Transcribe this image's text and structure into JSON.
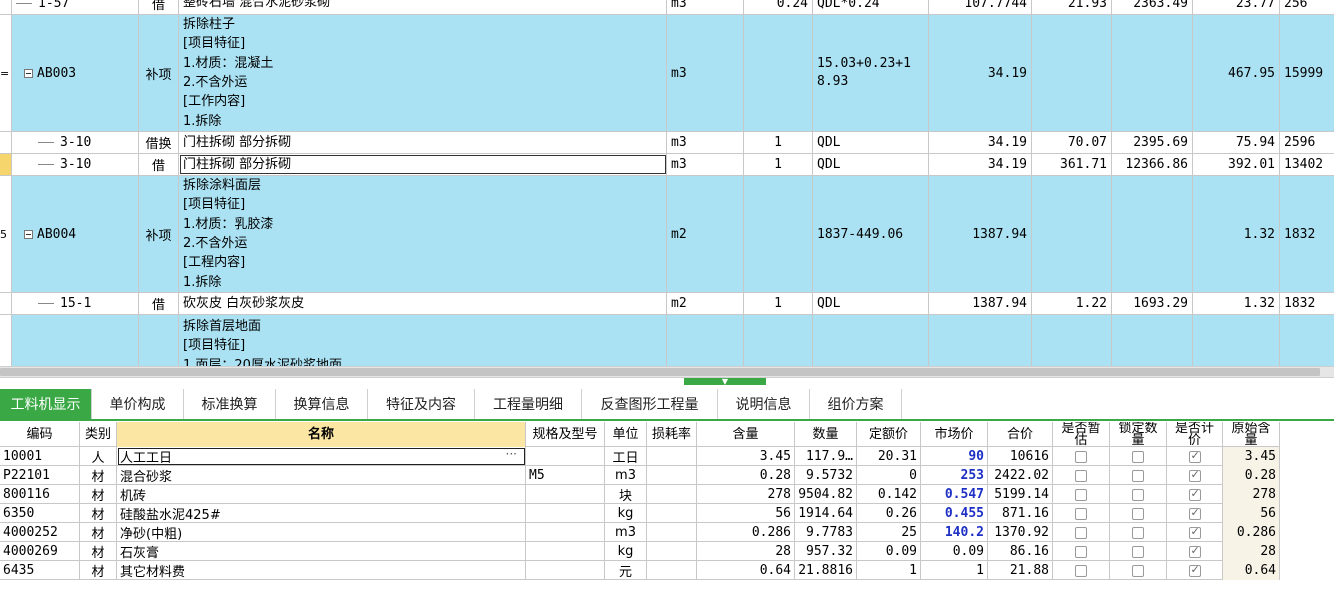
{
  "upper_rows": [
    {
      "indicator": "",
      "code": "1-57",
      "type": "借",
      "desc": [
        "整砖石墙 混合水泥砂浆砌"
      ],
      "unit": "m3",
      "qty_ratio": "0.24",
      "expr": "QDL*0.24",
      "quantity": "107.7744",
      "unit_price": "21.93",
      "total": "2363.49",
      "rate": "23.77",
      "last": "256"
    },
    {
      "indicator": "=",
      "code": "AB003",
      "type": "补项",
      "desc": [
        "拆除柱子",
        "[项目特征]",
        "1.材质：混凝土",
        "2.不含外运",
        "[工作内容]",
        "1.拆除"
      ],
      "unit": "m3",
      "qty_ratio": "",
      "expr": "15.03+0.23+18.93",
      "quantity": "34.19",
      "unit_price": "",
      "total": "",
      "rate": "467.95",
      "last": "15999"
    },
    {
      "indicator": "",
      "code": "3-10",
      "type": "借换",
      "desc": [
        "门柱拆砌 部分拆砌"
      ],
      "unit": "m3",
      "qty_ratio": "1",
      "expr": "QDL",
      "quantity": "34.19",
      "unit_price": "70.07",
      "total": "2395.69",
      "rate": "75.94",
      "last": "2596"
    },
    {
      "indicator": "",
      "code": "3-10",
      "type": "借",
      "desc": [
        "门柱拆砌 部分拆砌"
      ],
      "unit": "m3",
      "qty_ratio": "1",
      "expr": "QDL",
      "quantity": "34.19",
      "unit_price": "361.71",
      "total": "12366.86",
      "rate": "392.01",
      "last": "13402"
    },
    {
      "indicator": "5",
      "code": "AB004",
      "type": "补项",
      "desc": [
        "拆除涂料面层",
        "[项目特征]",
        "1.材质：乳胶漆",
        "2.不含外运",
        "[工程内容]",
        "1.拆除"
      ],
      "unit": "m2",
      "qty_ratio": "",
      "expr": "1837-449.06",
      "quantity": "1387.94",
      "unit_price": "",
      "total": "",
      "rate": "1.32",
      "last": "1832"
    },
    {
      "indicator": "",
      "code": "15-1",
      "type": "借",
      "desc": [
        "砍灰皮 白灰砂浆灰皮"
      ],
      "unit": "m2",
      "qty_ratio": "1",
      "expr": "QDL",
      "quantity": "1387.94",
      "unit_price": "1.22",
      "total": "1693.29",
      "rate": "1.32",
      "last": "1832"
    },
    {
      "indicator": "",
      "code": "",
      "type": "",
      "desc": [
        "拆除首层地面",
        "[项目特征]",
        "1.面层：20厚水泥砂浆地面"
      ],
      "unit": "",
      "qty_ratio": "",
      "expr": "",
      "quantity": "",
      "unit_price": "",
      "total": "",
      "rate": "",
      "last": ""
    }
  ],
  "tabs": [
    "工料机显示",
    "单价构成",
    "标准换算",
    "换算信息",
    "特征及内容",
    "工程量明细",
    "反查图形工程量",
    "说明信息",
    "组价方案"
  ],
  "lower_headers": [
    "编码",
    "类别",
    "名称",
    "规格及型号",
    "单位",
    "损耗率",
    "含量",
    "数量",
    "定额价",
    "市场价",
    "合价",
    "是否暂估",
    "锁定数量",
    "是否计价",
    "原始含量"
  ],
  "lower_rows": [
    {
      "code": "10001",
      "cat": "人",
      "name": "人工工日",
      "spec": "",
      "unit": "工日",
      "loss": "",
      "content": "3.45",
      "qty": "117.9…",
      "quota": "20.31",
      "market": "90",
      "total": "10616",
      "est": false,
      "lock": false,
      "priced": true,
      "orig": "3.45"
    },
    {
      "code": "P22101",
      "cat": "材",
      "name": "混合砂浆",
      "spec": "M5",
      "unit": "m3",
      "loss": "",
      "content": "0.28",
      "qty": "9.5732",
      "quota": "0",
      "market": "253",
      "total": "2422.02",
      "est": false,
      "lock": false,
      "priced": true,
      "orig": "0.28"
    },
    {
      "code": "800116",
      "cat": "材",
      "name": "机砖",
      "spec": "",
      "unit": "块",
      "loss": "",
      "content": "278",
      "qty": "9504.82",
      "quota": "0.142",
      "market": "0.547",
      "total": "5199.14",
      "est": false,
      "lock": false,
      "priced": true,
      "orig": "278"
    },
    {
      "code": "6350",
      "cat": "材",
      "name": "硅酸盐水泥425#",
      "spec": "",
      "unit": "kg",
      "loss": "",
      "content": "56",
      "qty": "1914.64",
      "quota": "0.26",
      "market": "0.455",
      "total": "871.16",
      "est": false,
      "lock": false,
      "priced": true,
      "orig": "56"
    },
    {
      "code": "4000252",
      "cat": "材",
      "name": "净砂(中粗)",
      "spec": "",
      "unit": "m3",
      "loss": "",
      "content": "0.286",
      "qty": "9.7783",
      "quota": "25",
      "market": "140.2",
      "total": "1370.92",
      "est": false,
      "lock": false,
      "priced": true,
      "orig": "0.286"
    },
    {
      "code": "4000269",
      "cat": "材",
      "name": "石灰膏",
      "spec": "",
      "unit": "kg",
      "loss": "",
      "content": "28",
      "qty": "957.32",
      "quota": "0.09",
      "market": "0.09",
      "total": "86.16",
      "est": false,
      "lock": false,
      "priced": true,
      "orig": "28"
    },
    {
      "code": "6435",
      "cat": "材",
      "name": "其它材料费",
      "spec": "",
      "unit": "元",
      "loss": "",
      "content": "0.64",
      "qty": "21.8816",
      "quota": "1",
      "market": "1",
      "total": "21.88",
      "est": false,
      "lock": false,
      "priced": true,
      "orig": "0.64"
    }
  ],
  "blue_market_rows": [
    0,
    1,
    2,
    3,
    4
  ],
  "splitter_icon": "chevron-down-icon",
  "ellipsis": "···"
}
